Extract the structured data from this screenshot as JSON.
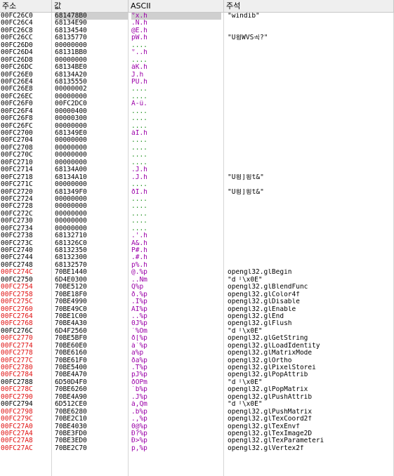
{
  "headers": {
    "address": "주소",
    "value": "값",
    "ascii": "ASCII",
    "comment": "주석"
  },
  "rows": [
    {
      "addr": "00FC26C0",
      "val": "681478B0",
      "ascii": "°x.h",
      "comment": "\"windib\"",
      "sel": true
    },
    {
      "addr": "00FC26C4",
      "val": "68134E90",
      "ascii": ".N.h",
      "comment": ""
    },
    {
      "addr": "00FC26C8",
      "val": "68134540",
      "ascii": "@E.h",
      "comment": ""
    },
    {
      "addr": "00FC26CC",
      "val": "68135770",
      "ascii": "pW.h",
      "comment": "\"U횡WVS곡?\""
    },
    {
      "addr": "00FC26D0",
      "val": "00000000",
      "ascii": "....",
      "comment": ""
    },
    {
      "addr": "00FC26D4",
      "val": "68131BB0",
      "ascii": "°..h",
      "comment": ""
    },
    {
      "addr": "00FC26D8",
      "val": "00000000",
      "ascii": "....",
      "comment": ""
    },
    {
      "addr": "00FC26DC",
      "val": "68134BE0",
      "ascii": "àK.h",
      "comment": ""
    },
    {
      "addr": "00FC26E0",
      "val": "68134A20",
      "ascii": " J.h",
      "comment": ""
    },
    {
      "addr": "00FC26E4",
      "val": "68135550",
      "ascii": "PU.h",
      "comment": ""
    },
    {
      "addr": "00FC26E8",
      "val": "00000002",
      "ascii": "....",
      "comment": ""
    },
    {
      "addr": "00FC26EC",
      "val": "00000000",
      "ascii": "....",
      "comment": ""
    },
    {
      "addr": "00FC26F0",
      "val": "00FC2DC0",
      "ascii": "À-ü.",
      "comment": ""
    },
    {
      "addr": "00FC26F4",
      "val": "00000400",
      "ascii": "....",
      "comment": ""
    },
    {
      "addr": "00FC26F8",
      "val": "00000300",
      "ascii": "....",
      "comment": ""
    },
    {
      "addr": "00FC26FC",
      "val": "00000000",
      "ascii": "....",
      "comment": ""
    },
    {
      "addr": "00FC2700",
      "val": "681349E0",
      "ascii": "àI.h",
      "comment": ""
    },
    {
      "addr": "00FC2704",
      "val": "00000000",
      "ascii": "....",
      "comment": ""
    },
    {
      "addr": "00FC2708",
      "val": "00000000",
      "ascii": "....",
      "comment": ""
    },
    {
      "addr": "00FC270C",
      "val": "00000000",
      "ascii": "....",
      "comment": ""
    },
    {
      "addr": "00FC2710",
      "val": "00000000",
      "ascii": "....",
      "comment": ""
    },
    {
      "addr": "00FC2714",
      "val": "68134A00",
      "ascii": ".J.h",
      "comment": ""
    },
    {
      "addr": "00FC2718",
      "val": "68134A10",
      "ascii": ".J.h",
      "comment": "\"U횡]횡t&\""
    },
    {
      "addr": "00FC271C",
      "val": "00000000",
      "ascii": "....",
      "comment": ""
    },
    {
      "addr": "00FC2720",
      "val": "681349F0",
      "ascii": "ðI.h",
      "comment": "\"U횡]횡t&\""
    },
    {
      "addr": "00FC2724",
      "val": "00000000",
      "ascii": "....",
      "comment": ""
    },
    {
      "addr": "00FC2728",
      "val": "00000000",
      "ascii": "....",
      "comment": ""
    },
    {
      "addr": "00FC272C",
      "val": "00000000",
      "ascii": "....",
      "comment": ""
    },
    {
      "addr": "00FC2730",
      "val": "00000000",
      "ascii": "....",
      "comment": ""
    },
    {
      "addr": "00FC2734",
      "val": "00000000",
      "ascii": "....",
      "comment": ""
    },
    {
      "addr": "00FC2738",
      "val": "68132710",
      "ascii": ".'.h",
      "comment": ""
    },
    {
      "addr": "00FC273C",
      "val": "681326C0",
      "ascii": "À&.h",
      "comment": ""
    },
    {
      "addr": "00FC2740",
      "val": "68132350",
      "ascii": "P#.h",
      "comment": ""
    },
    {
      "addr": "00FC2744",
      "val": "68132300",
      "ascii": ".#.h",
      "comment": ""
    },
    {
      "addr": "00FC2748",
      "val": "68132570",
      "ascii": "p%.h",
      "comment": ""
    },
    {
      "addr": "00FC274C",
      "imp": true,
      "val": "70BE1440",
      "ascii": "@.%p",
      "comment": "opengl32.glBegin"
    },
    {
      "addr": "00FC2750",
      "val": "6D4E0300",
      "ascii": "..Nm",
      "comment": "\"d「\\x0E\""
    },
    {
      "addr": "00FC2754",
      "imp": true,
      "val": "70BE5120",
      "ascii": " Q%p",
      "comment": "opengl32.glBlendFunc"
    },
    {
      "addr": "00FC2758",
      "imp": true,
      "val": "70BE18F0",
      "ascii": "ð.%p",
      "comment": "opengl32.glColor4f"
    },
    {
      "addr": "00FC275C",
      "imp": true,
      "val": "70BE4990",
      "ascii": ".I%p",
      "comment": "opengl32.glDisable"
    },
    {
      "addr": "00FC2760",
      "imp": true,
      "val": "70BE49C0",
      "ascii": "ÀI%p",
      "comment": "opengl32.glEnable"
    },
    {
      "addr": "00FC2764",
      "imp": true,
      "val": "70BE1C00",
      "ascii": "..%p",
      "comment": "opengl32.glEnd"
    },
    {
      "addr": "00FC2768",
      "imp": true,
      "val": "70BE4A30",
      "ascii": "0J%p",
      "comment": "opengl32.glFlush"
    },
    {
      "addr": "00FC276C",
      "val": "6D4F2560",
      "ascii": "`%Om",
      "comment": "\"d「\\x0E\""
    },
    {
      "addr": "00FC2770",
      "imp": true,
      "val": "70BE5BF0",
      "ascii": "ð[%p",
      "comment": "opengl32.glGetString"
    },
    {
      "addr": "00FC2774",
      "imp": true,
      "val": "70BE60E0",
      "ascii": "à`%p",
      "comment": "opengl32.glLoadIdentity"
    },
    {
      "addr": "00FC2778",
      "imp": true,
      "val": "70BE6160",
      "ascii": " a%p",
      "comment": "opengl32.glMatrixMode"
    },
    {
      "addr": "00FC277C",
      "imp": true,
      "val": "70BE61F0",
      "ascii": "ða%p",
      "comment": "opengl32.glOrtho"
    },
    {
      "addr": "00FC2780",
      "imp": true,
      "val": "70BE5400",
      "ascii": ".T%p",
      "comment": "opengl32.glPixelStorei"
    },
    {
      "addr": "00FC2784",
      "imp": true,
      "val": "70BE4A70",
      "ascii": "pJ%p",
      "comment": "opengl32.glPopAttrib"
    },
    {
      "addr": "00FC2788",
      "val": "6D50D4F0",
      "ascii": "ðÔPm",
      "comment": "\"d「\\x0E\""
    },
    {
      "addr": "00FC278C",
      "imp": true,
      "val": "70BE6260",
      "ascii": "`b%p",
      "comment": "opengl32.glPopMatrix"
    },
    {
      "addr": "00FC2790",
      "imp": true,
      "val": "70BE4A90",
      "ascii": ".J%p",
      "comment": "opengl32.glPushAttrib"
    },
    {
      "addr": "00FC2794",
      "val": "6D512CE0",
      "ascii": "à,Qm",
      "comment": "\"d「\\x0E\""
    },
    {
      "addr": "00FC2798",
      "imp": true,
      "val": "70BE6280",
      "ascii": ".b%p",
      "comment": "opengl32.glPushMatrix"
    },
    {
      "addr": "00FC279C",
      "imp": true,
      "val": "70BE2C10",
      "ascii": ".,%p",
      "comment": "opengl32.glTexCoord2f"
    },
    {
      "addr": "00FC27A0",
      "imp": true,
      "val": "70BE4030",
      "ascii": "0@%p",
      "comment": "opengl32.glTexEnvf"
    },
    {
      "addr": "00FC27A4",
      "imp": true,
      "val": "70BE3FD0",
      "ascii": "Ð?%p",
      "comment": "opengl32.glTexImage2D"
    },
    {
      "addr": "00FC27A8",
      "imp": true,
      "val": "70BE3ED0",
      "ascii": "Ð>%p",
      "comment": "opengl32.glTexParameteri"
    },
    {
      "addr": "00FC27AC",
      "imp": true,
      "val": "70BE2C70",
      "ascii": "p,%p",
      "comment": "opengl32.glVertex2f"
    }
  ]
}
